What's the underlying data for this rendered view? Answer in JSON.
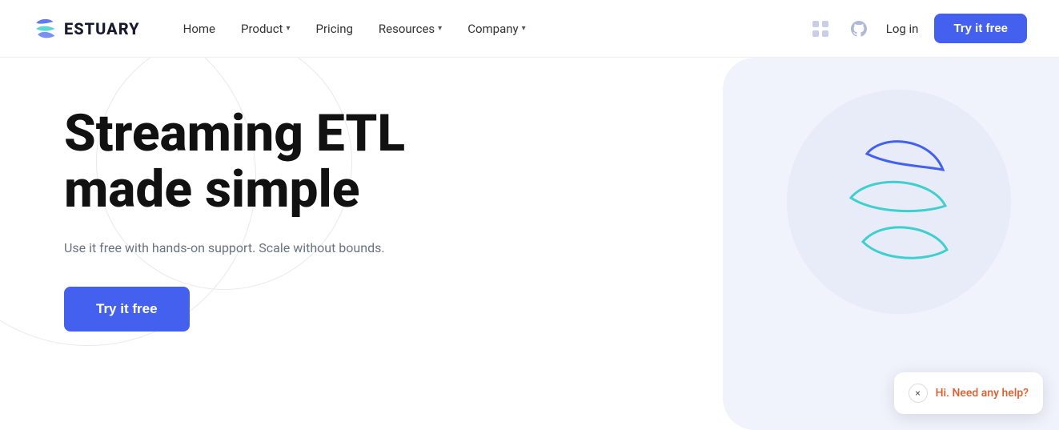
{
  "brand": {
    "name": "ESTUARY",
    "logo_alt": "Estuary Logo"
  },
  "nav": {
    "home_label": "Home",
    "product_label": "Product",
    "pricing_label": "Pricing",
    "resources_label": "Resources",
    "company_label": "Company",
    "login_label": "Log in",
    "try_free_label": "Try it free",
    "slack_icon": "slack-icon",
    "github_icon": "github-icon"
  },
  "hero": {
    "heading_line1": "Streaming ETL",
    "heading_line2": "made simple",
    "subtext": "Use it free with hands-on support. Scale without bounds.",
    "cta_label": "Try it free"
  },
  "chat": {
    "text": "Hi. Need any help?",
    "close_label": "×"
  },
  "colors": {
    "accent": "#4361ee",
    "chat_text": "#e05a2b",
    "hero_bg": "#f0f2fc"
  }
}
